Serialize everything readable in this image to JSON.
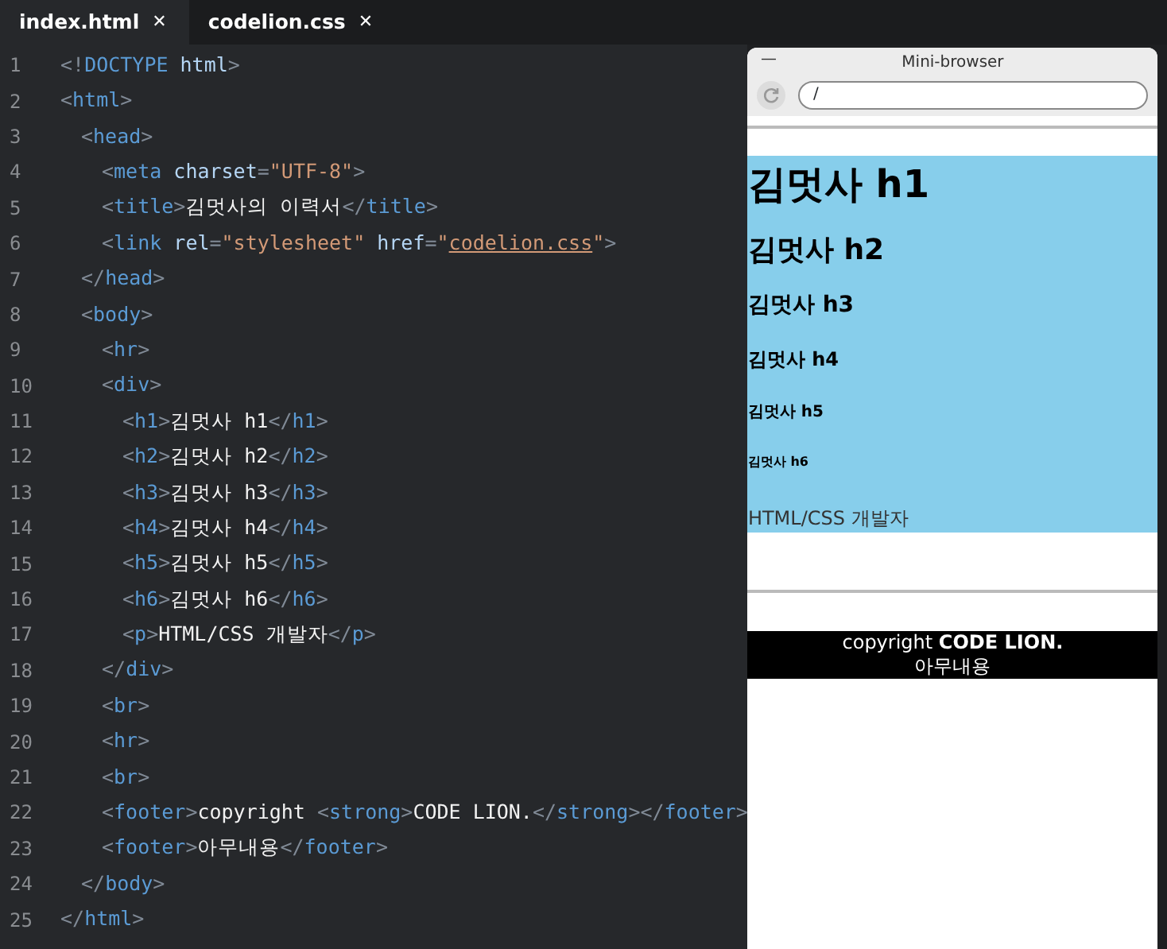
{
  "tabs": [
    {
      "label": "index.html",
      "close": "✕",
      "selected": true
    },
    {
      "label": "codelion.css",
      "close": "✕",
      "selected": false
    }
  ],
  "editor": {
    "lines": [
      {
        "number": "1",
        "tokens": [
          {
            "kind": "punct",
            "text": "<!"
          },
          {
            "kind": "tag",
            "text": "DOCTYPE"
          },
          {
            "kind": "attr",
            "text": " html"
          },
          {
            "kind": "punct",
            "text": ">"
          }
        ]
      },
      {
        "number": "2",
        "tokens": [
          {
            "kind": "punct",
            "text": "<"
          },
          {
            "kind": "tag",
            "text": "html"
          },
          {
            "kind": "punct",
            "text": ">"
          }
        ],
        "children": [
          {
            "number": "3",
            "tokens": [
              {
                "kind": "punct",
                "text": "<"
              },
              {
                "kind": "tag",
                "text": "head"
              },
              {
                "kind": "punct",
                "text": ">"
              }
            ],
            "children": [
              {
                "number": "4",
                "tokens": [
                  {
                    "kind": "punct",
                    "text": "<"
                  },
                  {
                    "kind": "tag",
                    "text": "meta"
                  },
                  {
                    "kind": "attr",
                    "text": " charset"
                  },
                  {
                    "kind": "punct",
                    "text": "="
                  },
                  {
                    "kind": "string",
                    "text": "\"UTF-8\""
                  },
                  {
                    "kind": "punct",
                    "text": ">"
                  }
                ]
              },
              {
                "number": "5",
                "tokens": [
                  {
                    "kind": "punct",
                    "text": "<"
                  },
                  {
                    "kind": "tag",
                    "text": "title"
                  },
                  {
                    "kind": "punct",
                    "text": ">"
                  },
                  {
                    "kind": "text",
                    "text": "김멋사의 이력서"
                  },
                  {
                    "kind": "punct",
                    "text": "</"
                  },
                  {
                    "kind": "tag",
                    "text": "title"
                  },
                  {
                    "kind": "punct",
                    "text": ">"
                  }
                ]
              },
              {
                "number": "6",
                "tokens": [
                  {
                    "kind": "punct",
                    "text": "<"
                  },
                  {
                    "kind": "tag",
                    "text": "link"
                  },
                  {
                    "kind": "attr",
                    "text": " rel"
                  },
                  {
                    "kind": "punct",
                    "text": "="
                  },
                  {
                    "kind": "string",
                    "text": "\"stylesheet\""
                  },
                  {
                    "kind": "attr",
                    "text": " href"
                  },
                  {
                    "kind": "punct",
                    "text": "="
                  },
                  {
                    "kind": "string",
                    "text": "\""
                  },
                  {
                    "kind": "link",
                    "text": "codelion.css"
                  },
                  {
                    "kind": "string",
                    "text": "\""
                  },
                  {
                    "kind": "punct",
                    "text": ">"
                  }
                ]
              }
            ]
          },
          {
            "number": "7",
            "tokens": [
              {
                "kind": "punct",
                "text": "</"
              },
              {
                "kind": "tag",
                "text": "head"
              },
              {
                "kind": "punct",
                "text": ">"
              }
            ]
          },
          {
            "number": "8",
            "tokens": [
              {
                "kind": "punct",
                "text": "<"
              },
              {
                "kind": "tag",
                "text": "body"
              },
              {
                "kind": "punct",
                "text": ">"
              }
            ],
            "children": [
              {
                "number": "9",
                "tokens": [
                  {
                    "kind": "punct",
                    "text": "<"
                  },
                  {
                    "kind": "tag",
                    "text": "hr"
                  },
                  {
                    "kind": "punct",
                    "text": ">"
                  }
                ]
              },
              {
                "number": "10",
                "tokens": [
                  {
                    "kind": "punct",
                    "text": "<"
                  },
                  {
                    "kind": "tag",
                    "text": "div"
                  },
                  {
                    "kind": "punct",
                    "text": ">"
                  }
                ],
                "children": [
                  {
                    "number": "11",
                    "tokens": [
                      {
                        "kind": "punct",
                        "text": "<"
                      },
                      {
                        "kind": "tag",
                        "text": "h1"
                      },
                      {
                        "kind": "punct",
                        "text": ">"
                      },
                      {
                        "kind": "text",
                        "text": "김멋사 h1"
                      },
                      {
                        "kind": "punct",
                        "text": "</"
                      },
                      {
                        "kind": "tag",
                        "text": "h1"
                      },
                      {
                        "kind": "punct",
                        "text": ">"
                      }
                    ]
                  },
                  {
                    "number": "12",
                    "tokens": [
                      {
                        "kind": "punct",
                        "text": "<"
                      },
                      {
                        "kind": "tag",
                        "text": "h2"
                      },
                      {
                        "kind": "punct",
                        "text": ">"
                      },
                      {
                        "kind": "text",
                        "text": "김멋사 h2"
                      },
                      {
                        "kind": "punct",
                        "text": "</"
                      },
                      {
                        "kind": "tag",
                        "text": "h2"
                      },
                      {
                        "kind": "punct",
                        "text": ">"
                      }
                    ]
                  },
                  {
                    "number": "13",
                    "tokens": [
                      {
                        "kind": "punct",
                        "text": "<"
                      },
                      {
                        "kind": "tag",
                        "text": "h3"
                      },
                      {
                        "kind": "punct",
                        "text": ">"
                      },
                      {
                        "kind": "text",
                        "text": "김멋사 h3"
                      },
                      {
                        "kind": "punct",
                        "text": "</"
                      },
                      {
                        "kind": "tag",
                        "text": "h3"
                      },
                      {
                        "kind": "punct",
                        "text": ">"
                      }
                    ]
                  },
                  {
                    "number": "14",
                    "tokens": [
                      {
                        "kind": "punct",
                        "text": "<"
                      },
                      {
                        "kind": "tag",
                        "text": "h4"
                      },
                      {
                        "kind": "punct",
                        "text": ">"
                      },
                      {
                        "kind": "text",
                        "text": "김멋사 h4"
                      },
                      {
                        "kind": "punct",
                        "text": "</"
                      },
                      {
                        "kind": "tag",
                        "text": "h4"
                      },
                      {
                        "kind": "punct",
                        "text": ">"
                      }
                    ]
                  },
                  {
                    "number": "15",
                    "tokens": [
                      {
                        "kind": "punct",
                        "text": "<"
                      },
                      {
                        "kind": "tag",
                        "text": "h5"
                      },
                      {
                        "kind": "punct",
                        "text": ">"
                      },
                      {
                        "kind": "text",
                        "text": "김멋사 h5"
                      },
                      {
                        "kind": "punct",
                        "text": "</"
                      },
                      {
                        "kind": "tag",
                        "text": "h5"
                      },
                      {
                        "kind": "punct",
                        "text": ">"
                      }
                    ]
                  },
                  {
                    "number": "16",
                    "tokens": [
                      {
                        "kind": "punct",
                        "text": "<"
                      },
                      {
                        "kind": "tag",
                        "text": "h6"
                      },
                      {
                        "kind": "punct",
                        "text": ">"
                      },
                      {
                        "kind": "text",
                        "text": "김멋사 h6"
                      },
                      {
                        "kind": "punct",
                        "text": "</"
                      },
                      {
                        "kind": "tag",
                        "text": "h6"
                      },
                      {
                        "kind": "punct",
                        "text": ">"
                      }
                    ]
                  },
                  {
                    "number": "17",
                    "tokens": [
                      {
                        "kind": "punct",
                        "text": "<"
                      },
                      {
                        "kind": "tag",
                        "text": "p"
                      },
                      {
                        "kind": "punct",
                        "text": ">"
                      },
                      {
                        "kind": "text",
                        "text": "HTML/CSS 개발자"
                      },
                      {
                        "kind": "punct",
                        "text": "</"
                      },
                      {
                        "kind": "tag",
                        "text": "p"
                      },
                      {
                        "kind": "punct",
                        "text": ">"
                      }
                    ]
                  }
                ]
              },
              {
                "number": "18",
                "tokens": [
                  {
                    "kind": "punct",
                    "text": "</"
                  },
                  {
                    "kind": "tag",
                    "text": "div"
                  },
                  {
                    "kind": "punct",
                    "text": ">"
                  }
                ]
              },
              {
                "number": "19",
                "tokens": [
                  {
                    "kind": "punct",
                    "text": "<"
                  },
                  {
                    "kind": "tag",
                    "text": "br"
                  },
                  {
                    "kind": "punct",
                    "text": ">"
                  }
                ]
              },
              {
                "number": "20",
                "tokens": [
                  {
                    "kind": "punct",
                    "text": "<"
                  },
                  {
                    "kind": "tag",
                    "text": "hr"
                  },
                  {
                    "kind": "punct",
                    "text": ">"
                  }
                ]
              },
              {
                "number": "21",
                "tokens": [
                  {
                    "kind": "punct",
                    "text": "<"
                  },
                  {
                    "kind": "tag",
                    "text": "br"
                  },
                  {
                    "kind": "punct",
                    "text": ">"
                  }
                ]
              },
              {
                "number": "22",
                "tokens": [
                  {
                    "kind": "punct",
                    "text": "<"
                  },
                  {
                    "kind": "tag",
                    "text": "footer"
                  },
                  {
                    "kind": "punct",
                    "text": ">"
                  },
                  {
                    "kind": "text",
                    "text": "copyright "
                  },
                  {
                    "kind": "punct",
                    "text": "<"
                  },
                  {
                    "kind": "tag",
                    "text": "strong"
                  },
                  {
                    "kind": "punct",
                    "text": ">"
                  },
                  {
                    "kind": "text",
                    "text": "CODE LION."
                  },
                  {
                    "kind": "punct",
                    "text": "</"
                  },
                  {
                    "kind": "tag",
                    "text": "strong"
                  },
                  {
                    "kind": "punct",
                    "text": "></"
                  },
                  {
                    "kind": "tag",
                    "text": "footer"
                  },
                  {
                    "kind": "punct",
                    "text": ">"
                  }
                ]
              },
              {
                "number": "23",
                "tokens": [
                  {
                    "kind": "punct",
                    "text": "<"
                  },
                  {
                    "kind": "tag",
                    "text": "footer"
                  },
                  {
                    "kind": "punct",
                    "text": ">"
                  },
                  {
                    "kind": "text",
                    "text": "아무내용"
                  },
                  {
                    "kind": "punct",
                    "text": "</"
                  },
                  {
                    "kind": "tag",
                    "text": "footer"
                  },
                  {
                    "kind": "punct",
                    "text": ">"
                  }
                ]
              }
            ]
          },
          {
            "number": "24",
            "tokens": [
              {
                "kind": "punct",
                "text": "</"
              },
              {
                "kind": "tag",
                "text": "body"
              },
              {
                "kind": "punct",
                "text": ">"
              }
            ]
          }
        ]
      },
      {
        "number": "25",
        "tokens": [
          {
            "kind": "punct",
            "text": "</"
          },
          {
            "kind": "tag",
            "text": "html"
          },
          {
            "kind": "punct",
            "text": ">"
          }
        ]
      }
    ]
  },
  "browser": {
    "title": "Mini-browser",
    "minimize": "—",
    "url": "/",
    "headings": [
      "김멋사 h1",
      "김멋사 h2",
      "김멋사 h3",
      "김멋사 h4",
      "김멋사 h5",
      "김멋사 h6"
    ],
    "paragraph": "HTML/CSS 개발자",
    "footers": [
      "copyright **CODE LION.**",
      "아무내용"
    ]
  }
}
